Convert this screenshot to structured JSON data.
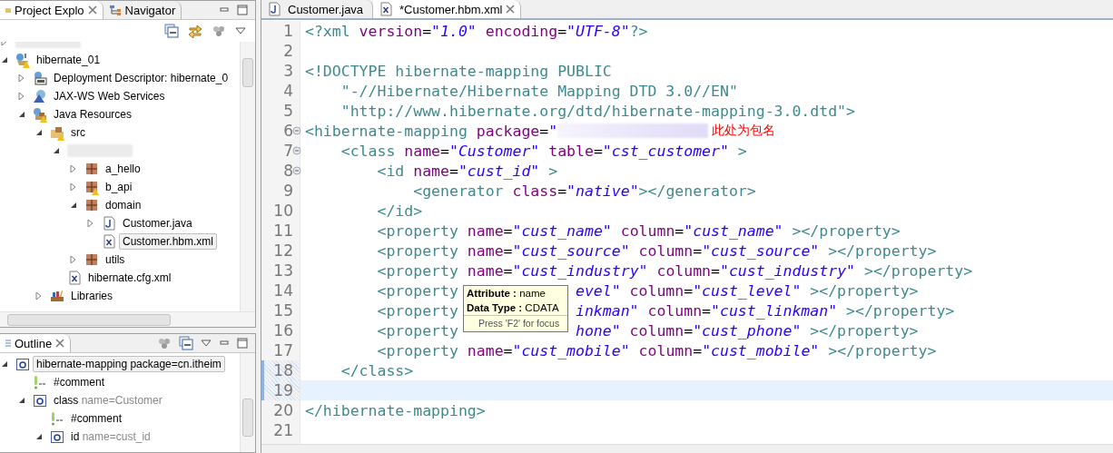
{
  "explorer": {
    "tabs": [
      {
        "label": "Project Explo",
        "selected": true
      },
      {
        "label": "Navigator",
        "selected": false
      }
    ],
    "tree": [
      {
        "kind": "redacted",
        "expanded": false,
        "selected": false,
        "warning": false
      },
      {
        "kind": "project",
        "label": "hibernate_01",
        "expanded": true,
        "selected": false,
        "warning": true,
        "children": [
          {
            "kind": "descriptor",
            "label": "Deployment Descriptor: hibernate_0",
            "expanded": false,
            "selected": false,
            "warning": false
          },
          {
            "kind": "webservices",
            "label": "JAX-WS Web Services",
            "expanded": false,
            "selected": false,
            "warning": false
          },
          {
            "kind": "resources",
            "label": "Java Resources",
            "expanded": true,
            "selected": false,
            "warning": true,
            "children": [
              {
                "kind": "source-folder",
                "label": "src",
                "expanded": true,
                "selected": false,
                "warning": true,
                "children": [
                  {
                    "kind": "redacted",
                    "expanded": true,
                    "selected": false,
                    "warning": false,
                    "children": [
                      {
                        "kind": "package",
                        "label": "a_hello",
                        "expanded": false,
                        "selected": false,
                        "warning": false
                      },
                      {
                        "kind": "package",
                        "label": "b_api",
                        "expanded": false,
                        "selected": false,
                        "warning": true
                      },
                      {
                        "kind": "package",
                        "label": "domain",
                        "expanded": true,
                        "selected": false,
                        "warning": false,
                        "children": [
                          {
                            "kind": "java-file",
                            "label": "Customer.java",
                            "expanded": false,
                            "selected": false,
                            "warning": false
                          },
                          {
                            "kind": "xml-file",
                            "label": "Customer.hbm.xml",
                            "selected": true,
                            "warning": false
                          }
                        ]
                      },
                      {
                        "kind": "package",
                        "label": "utils",
                        "expanded": false,
                        "selected": false,
                        "warning": false
                      }
                    ]
                  },
                  {
                    "kind": "xml-file",
                    "label": "hibernate.cfg.xml",
                    "selected": false,
                    "warning": false
                  }
                ]
              },
              {
                "kind": "library",
                "label": "Libraries",
                "expanded": false,
                "selected": false,
                "warning": false
              }
            ]
          }
        ]
      }
    ]
  },
  "outline": {
    "tab": {
      "label": "Outline",
      "selected": true
    },
    "tree": [
      {
        "kind": "element",
        "label": "hibernate-mapping package=cn.itheim",
        "expanded": true,
        "selected": true,
        "children": [
          {
            "kind": "comment",
            "label": "#comment",
            "selected": false
          },
          {
            "kind": "element",
            "label": "class",
            "detail": "name=Customer",
            "expanded": true,
            "selected": false,
            "children": [
              {
                "kind": "comment",
                "label": "#comment",
                "selected": false
              },
              {
                "kind": "element",
                "label": "id",
                "detail": "name=cust_id",
                "expanded": true,
                "selected": false
              }
            ]
          }
        ]
      }
    ]
  },
  "editor": {
    "tabs": [
      {
        "label": "Customer.java",
        "kind": "java",
        "selected": false
      },
      {
        "label": "*Customer.hbm.xml",
        "kind": "xml",
        "selected": true
      }
    ],
    "lines": [
      {
        "number": "1",
        "tokens": [
          {
            "kind": "tag",
            "text": "<?xml"
          },
          {
            "kind": "attr",
            "text": " version"
          },
          {
            "kind": "eq",
            "text": "="
          },
          {
            "kind": "val",
            "text": "\"1.0\""
          },
          {
            "kind": "attr",
            "text": " encoding"
          },
          {
            "kind": "eq",
            "text": "="
          },
          {
            "kind": "val",
            "text": "\"UTF-8\""
          },
          {
            "kind": "tag",
            "text": "?>"
          }
        ]
      },
      {
        "number": "2"
      },
      {
        "number": "3",
        "tokens": [
          {
            "kind": "tag",
            "text": "<!DOCTYPE hibernate-mapping"
          },
          {
            "kind": "dtd",
            "text": " PUBLIC"
          }
        ]
      },
      {
        "number": "4",
        "tokens": [
          {
            "kind": "dtd",
            "text": "    \"-//Hibernate/Hibernate Mapping DTD 3.0//EN\""
          }
        ]
      },
      {
        "number": "5",
        "tokens": [
          {
            "kind": "dtd",
            "text": "    \"http://www.hibernate.org/dtd/hibernate-mapping-3.0.dtd\""
          },
          {
            "kind": "tag",
            "text": ">"
          }
        ]
      },
      {
        "number": "6",
        "folded": false,
        "tokens": [
          {
            "kind": "tag",
            "text": "<hibernate-mapping"
          },
          {
            "kind": "attr",
            "text": " package"
          },
          {
            "kind": "eq",
            "text": "="
          },
          {
            "kind": "val",
            "text": "\""
          }
        ],
        "redacted": true,
        "note": "此处为包名"
      },
      {
        "number": "7",
        "folded": false,
        "tokens": [
          {
            "kind": "tag",
            "text": "    <class"
          },
          {
            "kind": "attr",
            "text": " name"
          },
          {
            "kind": "eq",
            "text": "="
          },
          {
            "kind": "val",
            "text": "\"Customer\""
          },
          {
            "kind": "attr",
            "text": " table"
          },
          {
            "kind": "eq",
            "text": "="
          },
          {
            "kind": "val",
            "text": "\"cst_customer\""
          },
          {
            "kind": "tag",
            "text": " >"
          }
        ]
      },
      {
        "number": "8",
        "folded": false,
        "tokens": [
          {
            "kind": "tag",
            "text": "        <id"
          },
          {
            "kind": "attr",
            "text": " name"
          },
          {
            "kind": "eq",
            "text": "="
          },
          {
            "kind": "val",
            "text": "\"cust_id\""
          },
          {
            "kind": "tag",
            "text": " >"
          }
        ]
      },
      {
        "number": "9",
        "tokens": [
          {
            "kind": "tag",
            "text": "            <generator"
          },
          {
            "kind": "attr",
            "text": " class"
          },
          {
            "kind": "eq",
            "text": "="
          },
          {
            "kind": "val",
            "text": "\"native\""
          },
          {
            "kind": "tag",
            "text": "></generator>"
          }
        ]
      },
      {
        "number": "10",
        "tokens": [
          {
            "kind": "tag",
            "text": "        </id>"
          }
        ]
      },
      {
        "number": "11",
        "tokens": [
          {
            "kind": "tag",
            "text": "        <property"
          },
          {
            "kind": "attr",
            "text": " name"
          },
          {
            "kind": "eq",
            "text": "="
          },
          {
            "kind": "val",
            "text": "\"cust_name\""
          },
          {
            "kind": "attr",
            "text": " column"
          },
          {
            "kind": "eq",
            "text": "="
          },
          {
            "kind": "val",
            "text": "\"cust_name\""
          },
          {
            "kind": "tag",
            "text": " ></property>"
          }
        ]
      },
      {
        "number": "12",
        "tokens": [
          {
            "kind": "tag",
            "text": "        <property"
          },
          {
            "kind": "attr",
            "text": " name"
          },
          {
            "kind": "eq",
            "text": "="
          },
          {
            "kind": "val",
            "text": "\"cust_source\""
          },
          {
            "kind": "attr",
            "text": " column"
          },
          {
            "kind": "eq",
            "text": "="
          },
          {
            "kind": "val",
            "text": "\"cust_source\""
          },
          {
            "kind": "tag",
            "text": " ></property>"
          }
        ]
      },
      {
        "number": "13",
        "tokens": [
          {
            "kind": "tag",
            "text": "        <property"
          },
          {
            "kind": "attr",
            "text": " name"
          },
          {
            "kind": "eq",
            "text": "="
          },
          {
            "kind": "val",
            "text": "\"cust_industry\""
          },
          {
            "kind": "attr",
            "text": " column"
          },
          {
            "kind": "eq",
            "text": "="
          },
          {
            "kind": "val",
            "text": "\"cust_industry\""
          },
          {
            "kind": "tag",
            "text": " ></property>"
          }
        ]
      },
      {
        "number": "14",
        "tokens": [
          {
            "kind": "tag",
            "text": "        <property"
          }
        ],
        "tail": [
          {
            "kind": "val",
            "text": "evel\""
          },
          {
            "kind": "attr",
            "text": " column"
          },
          {
            "kind": "eq",
            "text": "="
          },
          {
            "kind": "val",
            "text": "\"cust_level\""
          },
          {
            "kind": "tag",
            "text": " ></property>"
          }
        ]
      },
      {
        "number": "15",
        "tokens": [
          {
            "kind": "tag",
            "text": "        <property"
          }
        ],
        "tail": [
          {
            "kind": "val",
            "text": "inkman\""
          },
          {
            "kind": "attr",
            "text": " column"
          },
          {
            "kind": "eq",
            "text": "="
          },
          {
            "kind": "val",
            "text": "\"cust_linkman\""
          },
          {
            "kind": "tag",
            "text": " ></property>"
          }
        ]
      },
      {
        "number": "16",
        "tokens": [
          {
            "kind": "tag",
            "text": "        <property"
          }
        ],
        "tail": [
          {
            "kind": "val",
            "text": "hone\""
          },
          {
            "kind": "attr",
            "text": " column"
          },
          {
            "kind": "eq",
            "text": "="
          },
          {
            "kind": "val",
            "text": "\"cust_phone\""
          },
          {
            "kind": "tag",
            "text": " ></property>"
          }
        ]
      },
      {
        "number": "17",
        "tokens": [
          {
            "kind": "tag",
            "text": "        <property"
          },
          {
            "kind": "attr",
            "text": " name"
          },
          {
            "kind": "eq",
            "text": "="
          },
          {
            "kind": "val",
            "text": "\"cust_mobile\""
          },
          {
            "kind": "attr",
            "text": " column"
          },
          {
            "kind": "eq",
            "text": "="
          },
          {
            "kind": "val",
            "text": "\"cust_mobile\""
          },
          {
            "kind": "tag",
            "text": " ></property>"
          }
        ]
      },
      {
        "number": "18",
        "tokens": [
          {
            "kind": "tag",
            "text": "    </class>"
          }
        ]
      },
      {
        "number": "19",
        "current": true
      },
      {
        "number": "20",
        "tokens": [
          {
            "kind": "tag",
            "text": "</hibernate-mapping>"
          }
        ]
      },
      {
        "number": "21"
      }
    ],
    "tooltip": {
      "lines": [
        "**Attribute :** name",
        "**Data Type :** CDATA"
      ],
      "hint": "Press 'F2' for focus"
    }
  }
}
